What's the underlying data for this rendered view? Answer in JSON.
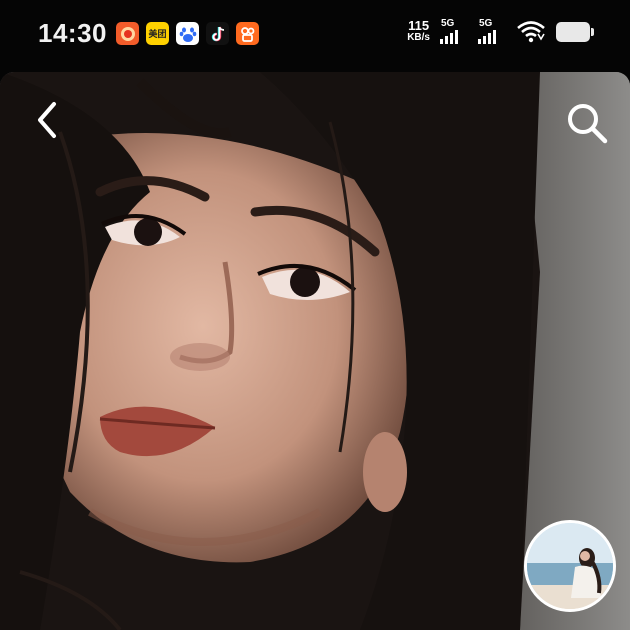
{
  "status_bar": {
    "time": "14:30",
    "app_icons": [
      {
        "icon": "orange-app-icon",
        "text": "",
        "color": "#f25c2a"
      },
      {
        "icon": "meituan-icon",
        "text": "美团",
        "color": "#ffd100"
      },
      {
        "icon": "baidu-icon",
        "text": "",
        "color": "#2f6bf5"
      },
      {
        "icon": "tiktok-icon",
        "text": "",
        "color": "#111111"
      },
      {
        "icon": "kuaishou-icon",
        "text": "",
        "color": "#ff6a1f"
      }
    ],
    "net_speed_value": "115",
    "net_speed_unit": "KB/s",
    "signal_1_label": "5G",
    "signal_2_label": "5G"
  },
  "toolbar": {
    "back_icon": "chevron-left-icon",
    "search_icon": "search-icon"
  },
  "colors": {
    "background": "#050505",
    "status_text": "#f2f2f2",
    "thumbnail_border": "#ffffff"
  }
}
